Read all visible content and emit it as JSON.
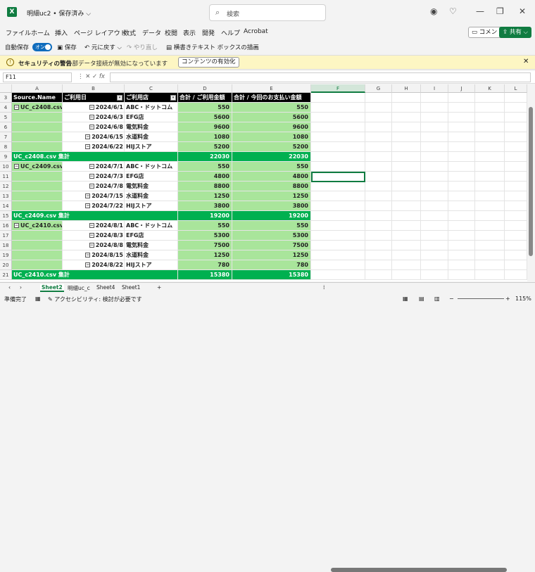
{
  "title": {
    "doc_title": "明細uc2 • 保存済み ⌵",
    "search_placeholder": "検索"
  },
  "menu": [
    "ファイル",
    "ホーム",
    "挿入",
    "ページ レイアウト",
    "数式",
    "データ",
    "校閲",
    "表示",
    "開発",
    "ヘルプ",
    "Acrobat"
  ],
  "menu_buttons": {
    "comment": "コメント",
    "share": "共有"
  },
  "toolbar": {
    "autosave": "自動保存",
    "toggle": "オン",
    "save": "保存",
    "undo": "元に戻す",
    "redo": "やり直し",
    "textbox": "横書きテキスト ボックスの描画"
  },
  "message": {
    "title": "セキュリティの警告",
    "text": "外部データ接続が無効になっています",
    "button": "コンテンツの有効化"
  },
  "formula": {
    "namebox": "F11"
  },
  "columns": [
    "A",
    "B",
    "C",
    "D",
    "E",
    "F",
    "G",
    "H",
    "I",
    "J",
    "K",
    "L"
  ],
  "headers": {
    "a": "Source.Name",
    "b": "ご利用日",
    "c": "ご利用店",
    "d": "合計 / ご利用金額",
    "e": "合計 / 今回のお支払い金額"
  },
  "rows": [
    {
      "r": "4",
      "a": "UC_c2408.csv",
      "b": "2024/6/1",
      "c": "ABC・ドットコム",
      "d": "550",
      "e": "550"
    },
    {
      "r": "5",
      "a": "",
      "b": "2024/6/3",
      "c": "EFG店",
      "d": "5600",
      "e": "5600"
    },
    {
      "r": "6",
      "a": "",
      "b": "2024/6/8",
      "c": "電気料金",
      "d": "9600",
      "e": "9600"
    },
    {
      "r": "7",
      "a": "",
      "b": "2024/6/15",
      "c": "水道料金",
      "d": "1080",
      "e": "1080"
    },
    {
      "r": "8",
      "a": "",
      "b": "2024/6/22",
      "c": "HIJストア",
      "d": "5200",
      "e": "5200"
    },
    {
      "r": "9",
      "total": true,
      "a": "UC_c2408.csv 集計",
      "d": "22030",
      "e": "22030"
    },
    {
      "r": "10",
      "a": "UC_c2409.csv",
      "b": "2024/7/1",
      "c": "ABC・ドットコム",
      "d": "550",
      "e": "550"
    },
    {
      "r": "11",
      "a": "",
      "b": "2024/7/3",
      "c": "EFG店",
      "d": "4800",
      "e": "4800"
    },
    {
      "r": "12",
      "a": "",
      "b": "2024/7/8",
      "c": "電気料金",
      "d": "8800",
      "e": "8800"
    },
    {
      "r": "13",
      "a": "",
      "b": "2024/7/15",
      "c": "水道料金",
      "d": "1250",
      "e": "1250"
    },
    {
      "r": "14",
      "a": "",
      "b": "2024/7/22",
      "c": "HIJストア",
      "d": "3800",
      "e": "3800"
    },
    {
      "r": "15",
      "total": true,
      "a": "UC_c2409.csv 集計",
      "d": "19200",
      "e": "19200"
    },
    {
      "r": "16",
      "a": "UC_c2410.csv",
      "b": "2024/8/1",
      "c": "ABC・ドットコム",
      "d": "550",
      "e": "550"
    },
    {
      "r": "17",
      "a": "",
      "b": "2024/8/3",
      "c": "EFG店",
      "d": "5300",
      "e": "5300"
    },
    {
      "r": "18",
      "a": "",
      "b": "2024/8/8",
      "c": "電気料金",
      "d": "7500",
      "e": "7500"
    },
    {
      "r": "19",
      "a": "",
      "b": "2024/8/15",
      "c": "水道料金",
      "d": "1250",
      "e": "1250"
    },
    {
      "r": "20",
      "a": "",
      "b": "2024/8/22",
      "c": "HIJストア",
      "d": "780",
      "e": "780"
    },
    {
      "r": "21",
      "total": true,
      "a": "UC_c2410.csv 集計",
      "d": "15380",
      "e": "15380"
    }
  ],
  "sheets": [
    "Sheet2",
    "明細uc_c",
    "Sheet4",
    "Sheet1"
  ],
  "status": {
    "ready": "準備完了",
    "accessibility": "アクセシビリティ: 検討が必要です",
    "zoom": "115%"
  },
  "colors": {
    "accent": "#107c41",
    "total": "#00b050",
    "green": "#a9e59b"
  }
}
